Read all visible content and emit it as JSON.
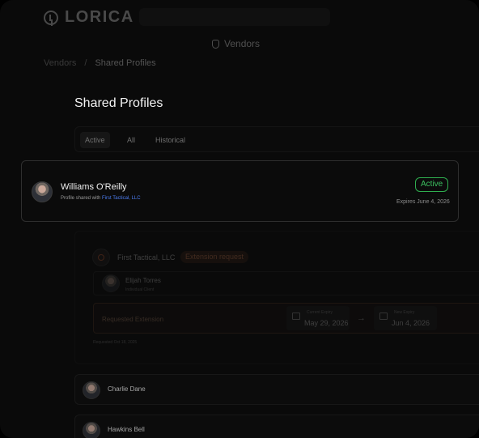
{
  "app": {
    "brand": "LORICA"
  },
  "nav": {
    "vendors_label": "Vendors"
  },
  "breadcrumb": {
    "items": [
      "Vendors",
      "Shared Profiles"
    ]
  },
  "page": {
    "title": "Shared Profiles"
  },
  "tabs": [
    "Active",
    "All",
    "Historical"
  ],
  "selected_profile": {
    "name": "Williams O'Reilly",
    "sub_prefix": "Profile shared with",
    "shared_with": "First Tactical, LLC",
    "status": "Active",
    "expires": "Expires June 4, 2026"
  },
  "extension_card": {
    "vendor": "First Tactical, LLC",
    "badge": "Extension request",
    "person_name": "Elijah Torres",
    "person_role": "Individual Client",
    "requested_label": "Requested Extension",
    "current_label": "Current Expiry",
    "current_date": "May 29, 2026",
    "new_label": "New Expiry",
    "new_date": "Jun 4, 2026",
    "footer": "Requested Oct 18, 2025"
  },
  "rows": [
    {
      "name": "Charlie Dane"
    },
    {
      "name": "Hawkins Bell"
    }
  ],
  "colors": {
    "accent_green": "#3cc060",
    "link_blue": "#4d7ef2",
    "orange": "#e38b5b"
  }
}
